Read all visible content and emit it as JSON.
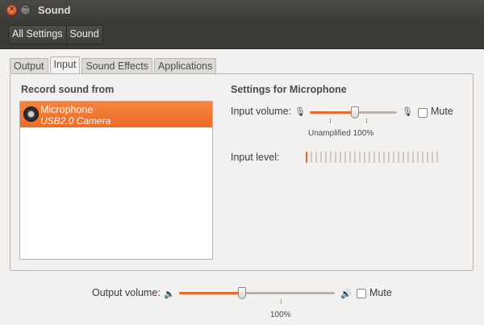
{
  "window": {
    "title": "Sound"
  },
  "toolbar": {
    "all_settings": "All Settings",
    "sound": "Sound"
  },
  "tabs": [
    {
      "label": "Output"
    },
    {
      "label": "Input",
      "active": true
    },
    {
      "label": "Sound Effects"
    },
    {
      "label": "Applications"
    }
  ],
  "left": {
    "heading": "Record sound from",
    "devices": [
      {
        "name": "Microphone",
        "detail": "USB2.0 Camera",
        "selected": true
      }
    ]
  },
  "right": {
    "heading": "Settings for Microphone",
    "input_volume_label": "Input volume:",
    "input_volume_percent": 100,
    "unamplified_label": "Unamplified",
    "percent_label": "100%",
    "mute_label": "Mute",
    "input_level_label": "Input level:",
    "input_level_active_segments": 1,
    "input_level_total_segments": 28
  },
  "bottom": {
    "output_volume_label": "Output volume:",
    "output_volume_percent": 100,
    "percent_label": "100%",
    "mute_label": "Mute"
  },
  "colors": {
    "accent": "#ef6c26",
    "titlebar": "#3c3b37",
    "background": "#f2f1f0"
  }
}
